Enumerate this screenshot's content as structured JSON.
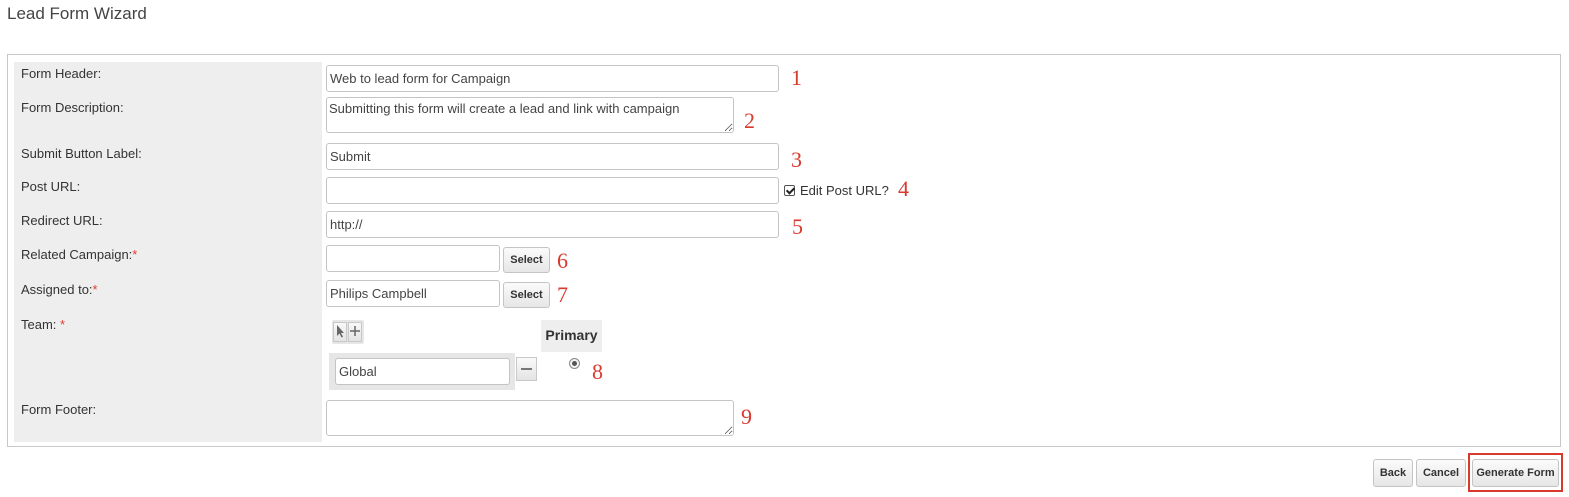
{
  "page": {
    "title": "Lead Form Wizard"
  },
  "form": {
    "header": {
      "label": "Form Header:",
      "value": "Web to lead form for Campaign",
      "marker": "1"
    },
    "description": {
      "label": "Form Description:",
      "value": "Submitting this form will create a lead and link with campaign",
      "marker": "2"
    },
    "submit_label": {
      "label": "Submit Button Label:",
      "value": "Submit",
      "marker": "3"
    },
    "post_url": {
      "label": "Post URL:",
      "value": "",
      "edit_label": "Edit Post URL?",
      "edit_checked": true,
      "marker": "4"
    },
    "redirect_url": {
      "label": "Redirect URL:",
      "value": "http://",
      "marker": "5"
    },
    "related_campaign": {
      "label": "Related Campaign:",
      "required_mark": "*",
      "value": "",
      "select_label": "Select",
      "marker": "6"
    },
    "assigned_to": {
      "label": "Assigned to:",
      "required_mark": "*",
      "value": "Philips Campbell",
      "select_label": "Select",
      "marker": "7"
    },
    "team": {
      "label": "Team: ",
      "required_mark": "*",
      "primary_header": "Primary",
      "value": "Global",
      "primary_selected": true,
      "marker": "8"
    },
    "footer": {
      "label": "Form Footer:",
      "value": "",
      "marker": "9"
    }
  },
  "actions": {
    "back": "Back",
    "cancel": "Cancel",
    "generate": "Generate Form"
  },
  "colors": {
    "marker": "#d93a2e",
    "required": "#e03c31",
    "label_column": "#eeeeee",
    "highlight_frame": "#d93a2e"
  }
}
